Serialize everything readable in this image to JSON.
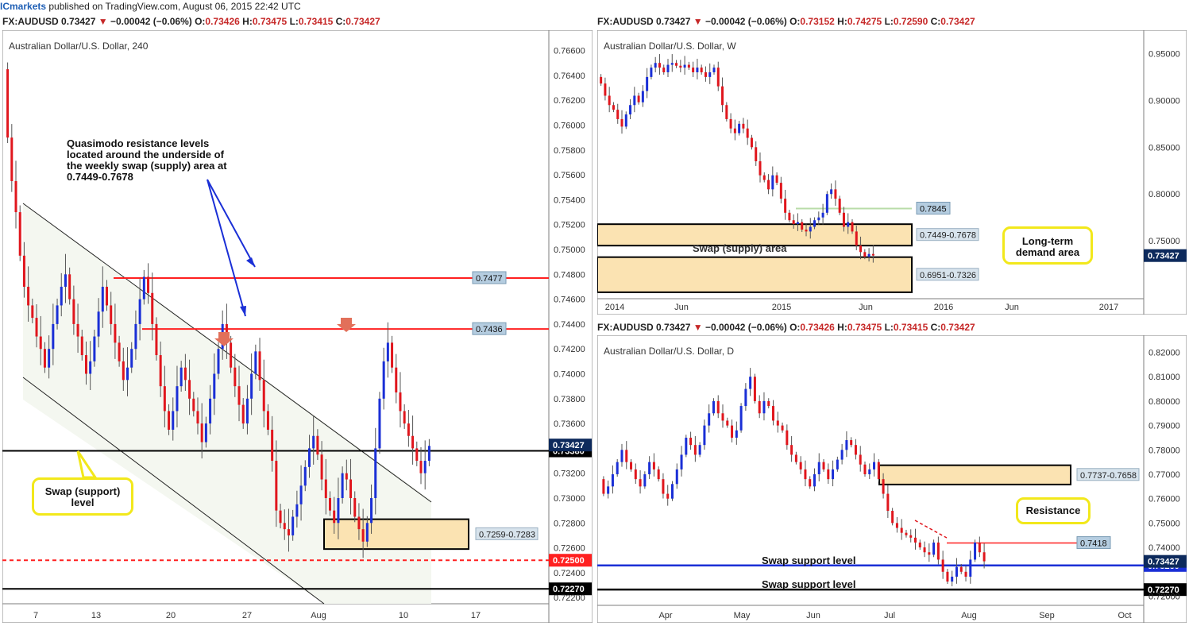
{
  "topbar": {
    "brand": "ICmarkets",
    "rest": " published on TradingView.com, August 06, 2015 22:42 UTC"
  },
  "headers": {
    "left": {
      "sym": "FX:AUDUSD",
      "last": "0.73427",
      "chg": "−0.00042 (−0.06%)",
      "o": "O:",
      "ov": "0.73426",
      "h": "H:",
      "hv": "0.73475",
      "l": "L:",
      "lv": "0.73415",
      "c": "C:",
      "cv": "0.73427"
    },
    "weekly": {
      "sym": "FX:AUDUSD",
      "last": "0.73427",
      "chg": "−0.00042 (−0.06%)",
      "o": "O:",
      "ov": "0.73152",
      "h": "H:",
      "hv": "0.74275",
      "l": "L:",
      "lv": "0.72590",
      "c": "C:",
      "cv": "0.73427"
    },
    "daily": {
      "sym": "FX:AUDUSD",
      "last": "0.73427",
      "chg": "−0.00042 (−0.06%)",
      "o": "O:",
      "ov": "0.73426",
      "h": "H:",
      "hv": "0.73475",
      "l": "L:",
      "lv": "0.73415",
      "c": "C:",
      "cv": "0.73427"
    }
  },
  "colors": {
    "up": "#1a2fd6",
    "down": "#e0161d",
    "level_red": "#ff2020",
    "level_blue": "#1a2fd6",
    "zone": "#fbe3b2",
    "axis_tag": "#b5cde0",
    "last_tag": "#0d2a5c",
    "annot": "#f2e81b"
  },
  "chart_data": [
    {
      "type": "candlestick",
      "title": "Australian Dollar/U.S. Dollar, 240",
      "ylim": [
        0.7215,
        0.767
      ],
      "y_ticks": [
        "0.76600",
        "0.76400",
        "0.76200",
        "0.76000",
        "0.75800",
        "0.75600",
        "0.75400",
        "0.75200",
        "0.75000",
        "0.74800",
        "0.74600",
        "0.74400",
        "0.74200",
        "0.74000",
        "0.73800",
        "0.73600",
        "0.73200",
        "0.73000",
        "0.72800",
        "0.72600",
        "0.72400",
        "0.72200"
      ],
      "x_ticks": [
        "7",
        "13",
        "20",
        "27",
        "Aug",
        "10",
        "17"
      ],
      "levels": [
        {
          "value": 0.7477,
          "label": "0.7477",
          "color": "red"
        },
        {
          "value": 0.7436,
          "label": "0.7436",
          "color": "red"
        },
        {
          "value": 0.7338,
          "label": "0.73380",
          "color": "black"
        },
        {
          "value": 0.725,
          "label": "0.72500",
          "color": "red-dashed"
        },
        {
          "value": 0.7227,
          "label": "0.72270",
          "color": "black"
        }
      ],
      "zones": [
        {
          "label": "0.7259-0.7283",
          "low": 0.7259,
          "high": 0.7283
        }
      ],
      "last_price": "0.73427",
      "annotations": [
        "Quasimodo resistance levels located around the underside of the weekly swap (supply) area at 0.7449-0.7678",
        "Swap (support) level"
      ],
      "price_path": [
        0.7645,
        0.759,
        0.7555,
        0.753,
        0.7495,
        0.747,
        0.7455,
        0.7445,
        0.743,
        0.742,
        0.7405,
        0.742,
        0.744,
        0.7455,
        0.747,
        0.748,
        0.746,
        0.744,
        0.743,
        0.7415,
        0.74,
        0.741,
        0.743,
        0.745,
        0.747,
        0.7455,
        0.744,
        0.7425,
        0.741,
        0.7395,
        0.7405,
        0.742,
        0.744,
        0.746,
        0.7478,
        0.7465,
        0.744,
        0.7415,
        0.739,
        0.737,
        0.7355,
        0.737,
        0.739,
        0.7405,
        0.7395,
        0.738,
        0.737,
        0.736,
        0.7345,
        0.736,
        0.738,
        0.74,
        0.742,
        0.744,
        0.7425,
        0.7405,
        0.739,
        0.7375,
        0.736,
        0.738,
        0.74,
        0.7418,
        0.7395,
        0.737,
        0.7355,
        0.733,
        0.729,
        0.728,
        0.7275,
        0.727,
        0.7285,
        0.7295,
        0.731,
        0.7325,
        0.734,
        0.735,
        0.7335,
        0.7315,
        0.73,
        0.729,
        0.728,
        0.73,
        0.732,
        0.7315,
        0.73,
        0.7285,
        0.7275,
        0.7265,
        0.728,
        0.73,
        0.734,
        0.738,
        0.741,
        0.7425,
        0.7405,
        0.7385,
        0.737,
        0.736,
        0.735,
        0.734,
        0.733,
        0.732,
        0.733,
        0.7342
      ]
    },
    {
      "type": "candlestick",
      "title": "Australian Dollar/U.S. Dollar, W",
      "ylim": [
        0.695,
        0.958
      ],
      "y_ticks": [
        "0.95000",
        "0.90000",
        "0.85000",
        "0.80000",
        "0.75000"
      ],
      "x_ticks": [
        "2014",
        "Jun",
        "2015",
        "Jun",
        "2016",
        "Jun",
        "2017"
      ],
      "levels": [
        {
          "value": 0.7845,
          "label": "0.7845"
        }
      ],
      "zones": [
        {
          "label": "0.7449-0.7678",
          "low": 0.7449,
          "high": 0.7678,
          "name": "Swap (supply) area"
        },
        {
          "label": "0.6951-0.7326",
          "low": 0.6951,
          "high": 0.7326
        }
      ],
      "last_price": "0.73427",
      "annotations": [
        "Long-term demand area"
      ],
      "price_path": [
        0.925,
        0.918,
        0.905,
        0.895,
        0.89,
        0.88,
        0.872,
        0.885,
        0.895,
        0.905,
        0.898,
        0.91,
        0.925,
        0.935,
        0.94,
        0.935,
        0.93,
        0.938,
        0.94,
        0.937,
        0.935,
        0.938,
        0.935,
        0.93,
        0.935,
        0.93,
        0.925,
        0.93,
        0.935,
        0.915,
        0.895,
        0.88,
        0.87,
        0.865,
        0.875,
        0.87,
        0.86,
        0.85,
        0.835,
        0.82,
        0.815,
        0.805,
        0.82,
        0.812,
        0.795,
        0.78,
        0.772,
        0.768,
        0.77,
        0.762,
        0.76,
        0.765,
        0.772,
        0.775,
        0.78,
        0.8,
        0.805,
        0.795,
        0.78,
        0.765,
        0.77,
        0.76,
        0.745,
        0.738,
        0.733,
        0.736,
        0.7343
      ]
    },
    {
      "type": "candlestick",
      "title": "Australian Dollar/U.S. Dollar, D",
      "ylim": [
        0.7195,
        0.8205
      ],
      "y_ticks": [
        "0.82000",
        "0.81000",
        "0.80000",
        "0.79000",
        "0.78000",
        "0.77000",
        "0.76000",
        "0.75000",
        "0.74000",
        "0.72000"
      ],
      "x_ticks": [
        "Apr",
        "May",
        "Jun",
        "Jul",
        "Aug",
        "Sep",
        "Oct"
      ],
      "levels": [
        {
          "value": 0.7418,
          "label": "0.7418",
          "color": "red"
        },
        {
          "value": 0.7326,
          "label": "0.73260",
          "color": "blue",
          "name": "Swap support level"
        },
        {
          "value": 0.7227,
          "label": "0.72270",
          "color": "black",
          "name": "Swap support level"
        }
      ],
      "zones": [
        {
          "label": "0.7737-0.7658",
          "low": 0.7658,
          "high": 0.7737
        }
      ],
      "last_price": "0.73427",
      "annotations": [
        "Resistance"
      ],
      "price_path": [
        0.768,
        0.762,
        0.765,
        0.77,
        0.775,
        0.78,
        0.775,
        0.772,
        0.768,
        0.765,
        0.77,
        0.775,
        0.772,
        0.768,
        0.762,
        0.76,
        0.766,
        0.772,
        0.778,
        0.785,
        0.782,
        0.778,
        0.782,
        0.79,
        0.795,
        0.8,
        0.795,
        0.792,
        0.79,
        0.785,
        0.788,
        0.798,
        0.805,
        0.81,
        0.8,
        0.795,
        0.8,
        0.798,
        0.792,
        0.79,
        0.788,
        0.782,
        0.778,
        0.775,
        0.772,
        0.768,
        0.765,
        0.77,
        0.775,
        0.772,
        0.768,
        0.772,
        0.776,
        0.78,
        0.784,
        0.782,
        0.778,
        0.774,
        0.77,
        0.772,
        0.775,
        0.768,
        0.762,
        0.755,
        0.75,
        0.748,
        0.746,
        0.745,
        0.744,
        0.742,
        0.74,
        0.738,
        0.737,
        0.742,
        0.735,
        0.73,
        0.726,
        0.728,
        0.732,
        0.73,
        0.728,
        0.735,
        0.742,
        0.738,
        0.7343
      ]
    }
  ]
}
